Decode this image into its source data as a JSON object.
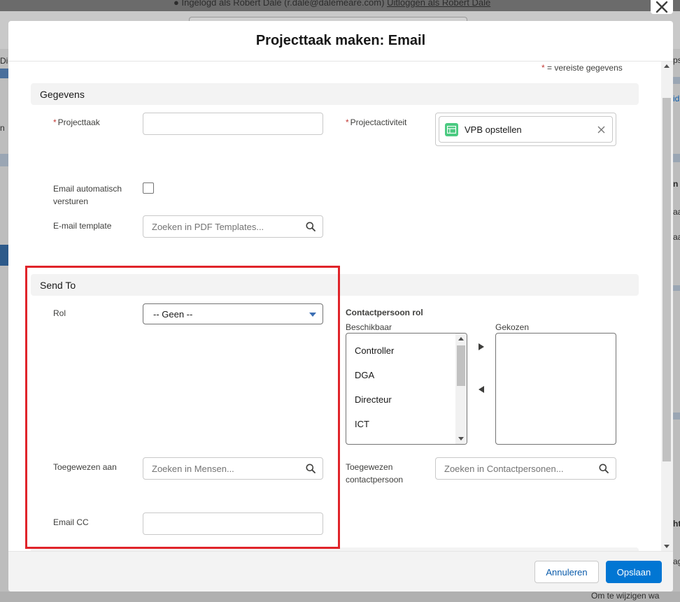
{
  "background": {
    "session_text": "Ingelogd als Robert Dale (r.dale@dalemeare.com)",
    "logout_link": "Uitloggen als Robert Dale",
    "frag_di": "Di",
    "frag_n": "n",
    "frag_ps": "ps",
    "frag_id": "id",
    "frag_n2": "n",
    "frag_aa1": "aa",
    "frag_aa2": "aa",
    "frag_ht": "ht",
    "frag_ag": "ag",
    "frag_bottom": "Om te wijzigen wa"
  },
  "modal": {
    "title": "Projecttaak maken: Email",
    "required_asterisk": "*",
    "required_note": " = vereiste gegevens"
  },
  "sections": {
    "gegevens": "Gegevens",
    "send_to": "Send To"
  },
  "fields": {
    "projecttaak": {
      "label": "Projecttaak",
      "value": ""
    },
    "projectactiviteit": {
      "label": "Projectactiviteit",
      "selected": "VPB opstellen"
    },
    "email_auto": {
      "label_line1": "Email automatisch",
      "label_line2": "versturen",
      "checked": false
    },
    "email_template": {
      "label": "E-mail template",
      "placeholder": "Zoeken in PDF Templates..."
    },
    "rol": {
      "label": "Rol",
      "value": "-- Geen --"
    },
    "contactpersoon_rol": {
      "label": "Contactpersoon rol",
      "available_label": "Beschikbaar",
      "chosen_label": "Gekozen",
      "available": [
        "Controller",
        "DGA",
        "Directeur",
        "ICT"
      ],
      "chosen": []
    },
    "toegewezen_aan": {
      "label": "Toegewezen aan",
      "placeholder": "Zoeken in Mensen..."
    },
    "toegewezen_contact": {
      "label_line1": "Toegewezen",
      "label_line2": "contactpersoon",
      "placeholder": "Zoeken in Contactpersonen..."
    },
    "email_cc": {
      "label": "Email CC",
      "value": ""
    }
  },
  "footer": {
    "cancel": "Annuleren",
    "save": "Opslaan"
  },
  "colors": {
    "brand": "#0176d3",
    "highlight": "#e0242a",
    "activity_icon": "#4bca81"
  }
}
